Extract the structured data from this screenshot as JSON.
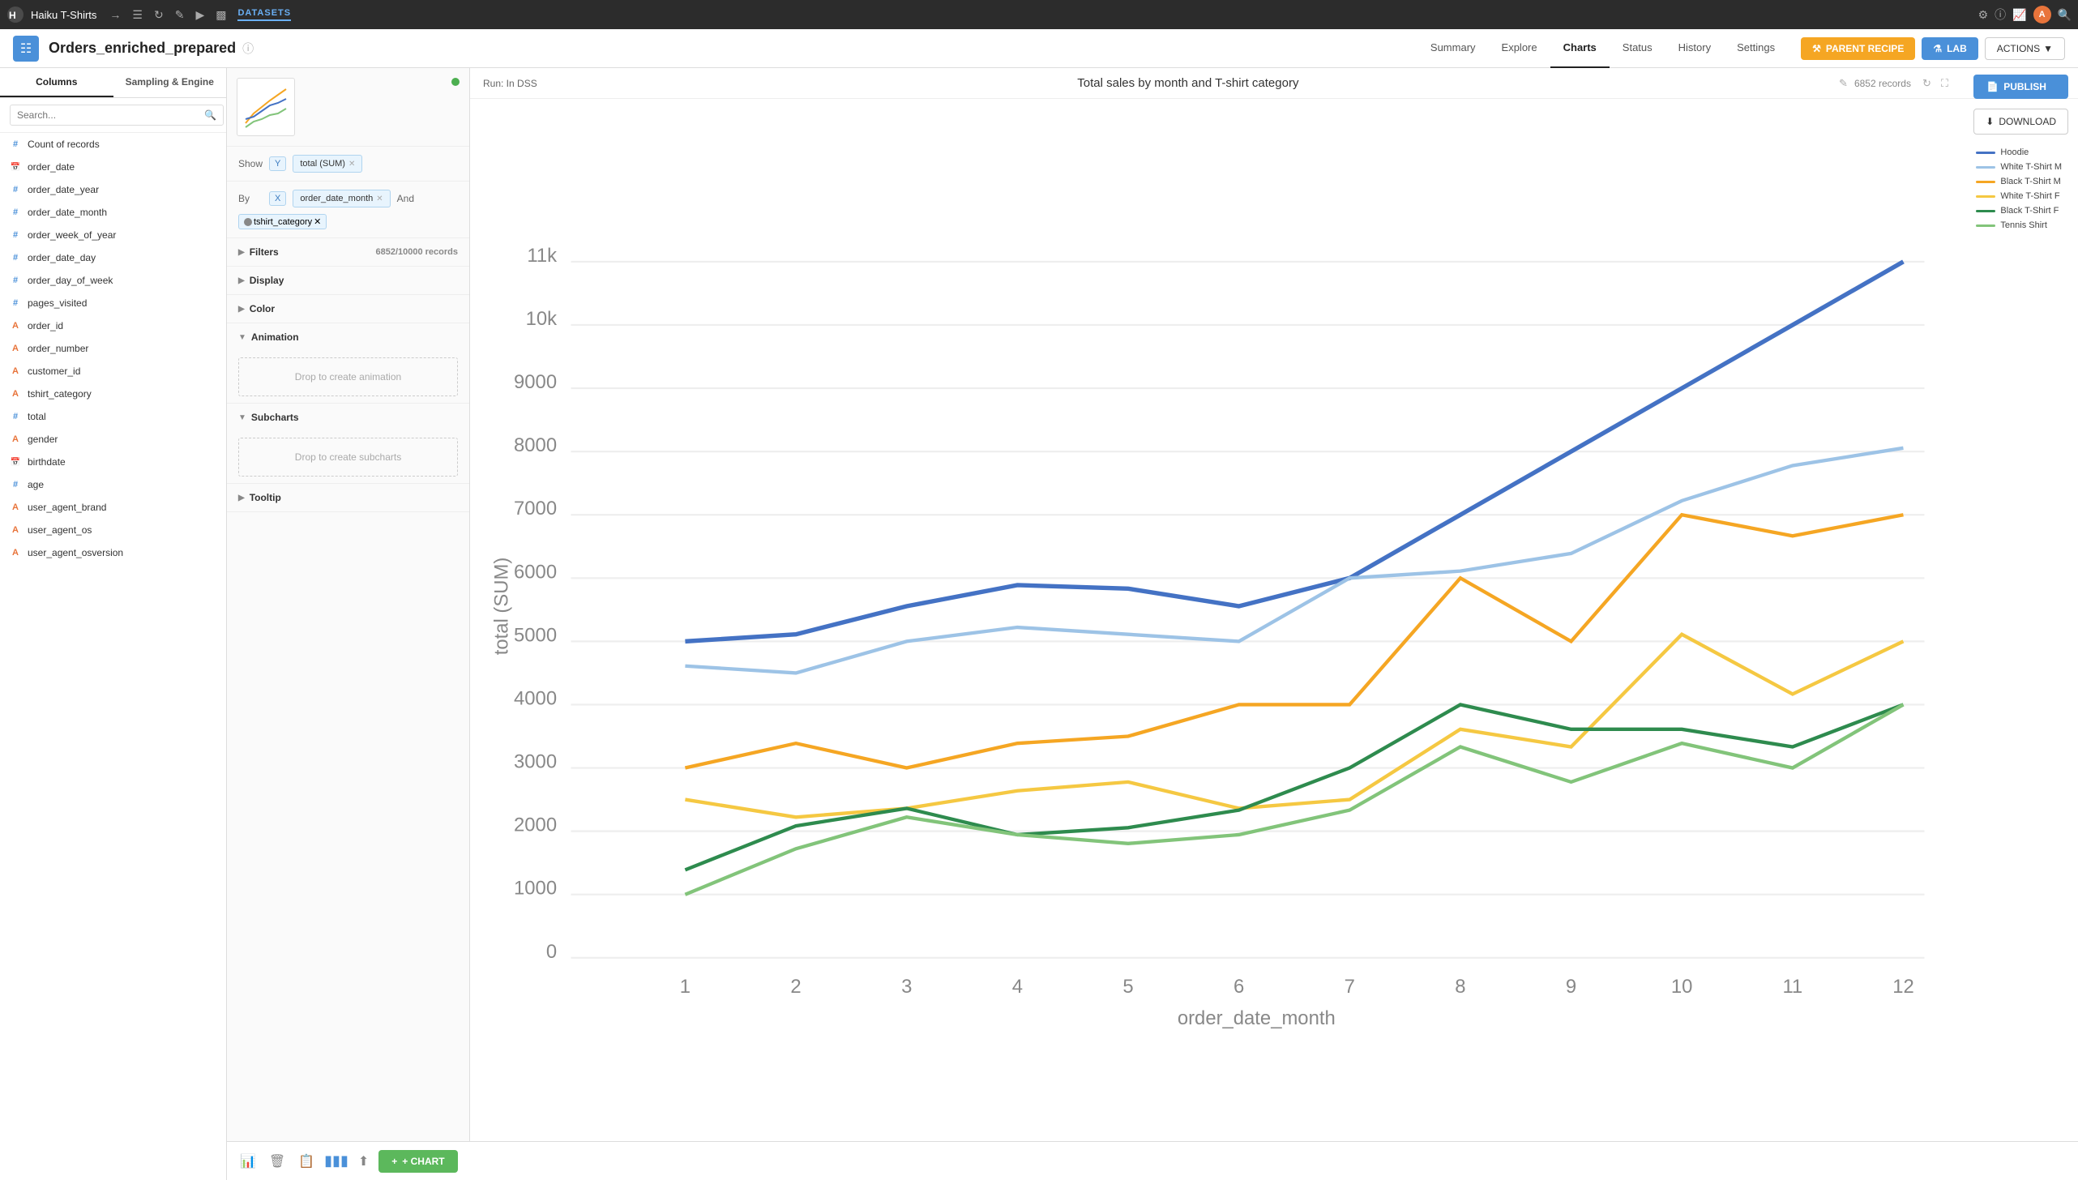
{
  "app": {
    "name": "Haiku T-Shirts",
    "section": "DATASETS"
  },
  "dataset": {
    "name": "Orders_enriched_prepared",
    "tabs": [
      "Summary",
      "Explore",
      "Charts",
      "Status",
      "History",
      "Settings"
    ],
    "active_tab": "Charts"
  },
  "buttons": {
    "parent_recipe": "PARENT RECIPE",
    "lab": "LAB",
    "actions": "ACTIONS",
    "publish": "PUBLISH",
    "download": "DOWNLOAD",
    "add_chart": "+ CHART"
  },
  "sidebar": {
    "tabs": [
      "Columns",
      "Sampling & Engine"
    ],
    "active_tab": "Columns",
    "search_placeholder": "Search...",
    "columns": [
      {
        "type": "hash",
        "name": "Count of records"
      },
      {
        "type": "cal",
        "name": "order_date"
      },
      {
        "type": "hash",
        "name": "order_date_year"
      },
      {
        "type": "hash",
        "name": "order_date_month"
      },
      {
        "type": "hash",
        "name": "order_week_of_year"
      },
      {
        "type": "hash",
        "name": "order_date_day"
      },
      {
        "type": "hash",
        "name": "order_day_of_week"
      },
      {
        "type": "hash",
        "name": "pages_visited"
      },
      {
        "type": "a",
        "name": "order_id"
      },
      {
        "type": "a",
        "name": "order_number"
      },
      {
        "type": "a",
        "name": "customer_id"
      },
      {
        "type": "a",
        "name": "tshirt_category"
      },
      {
        "type": "hash",
        "name": "total"
      },
      {
        "type": "a",
        "name": "gender"
      },
      {
        "type": "cal",
        "name": "birthdate"
      },
      {
        "type": "hash",
        "name": "age"
      },
      {
        "type": "a",
        "name": "user_agent_brand"
      },
      {
        "type": "a",
        "name": "user_agent_os"
      },
      {
        "type": "a",
        "name": "user_agent_osversion"
      }
    ]
  },
  "chart_config": {
    "show_label": "Show",
    "by_label": "By",
    "and_label": "And",
    "y_axis": "Y",
    "x_axis": "X",
    "show_field": "total (SUM)",
    "by_field": "order_date_month",
    "color_field": "tshirt_category",
    "filters_label": "Filters",
    "filters_count": "6852/10000 records",
    "display_label": "Display",
    "color_label": "Color",
    "animation_label": "Animation",
    "animation_drop": "Drop to create animation",
    "subcharts_label": "Subcharts",
    "subcharts_drop": "Drop to create subcharts",
    "tooltip_label": "Tooltip"
  },
  "chart": {
    "run_label": "Run: In DSS",
    "title": "Total sales by month and T-shirt category",
    "records": "6852 records",
    "y_axis_label": "total (SUM)",
    "x_axis_label": "order_date_month",
    "legend": [
      {
        "label": "Hoodie",
        "color": "#4472c4"
      },
      {
        "label": "White T-Shirt M",
        "color": "#a8c4e0"
      },
      {
        "label": "Black T-Shirt M",
        "color": "#f5a623"
      },
      {
        "label": "White T-Shirt F",
        "color": "#f5c842"
      },
      {
        "label": "Black T-Shirt F",
        "color": "#2e8b4e"
      },
      {
        "label": "Tennis Shirt",
        "color": "#82c47a"
      }
    ],
    "y_ticks": [
      "0",
      "1000",
      "2000",
      "3000",
      "4000",
      "5000",
      "6000",
      "7000",
      "8000",
      "9000",
      "10k",
      "11k"
    ],
    "x_ticks": [
      "1",
      "2",
      "3",
      "4",
      "5",
      "6",
      "7",
      "8",
      "9",
      "10",
      "11",
      "12"
    ]
  }
}
